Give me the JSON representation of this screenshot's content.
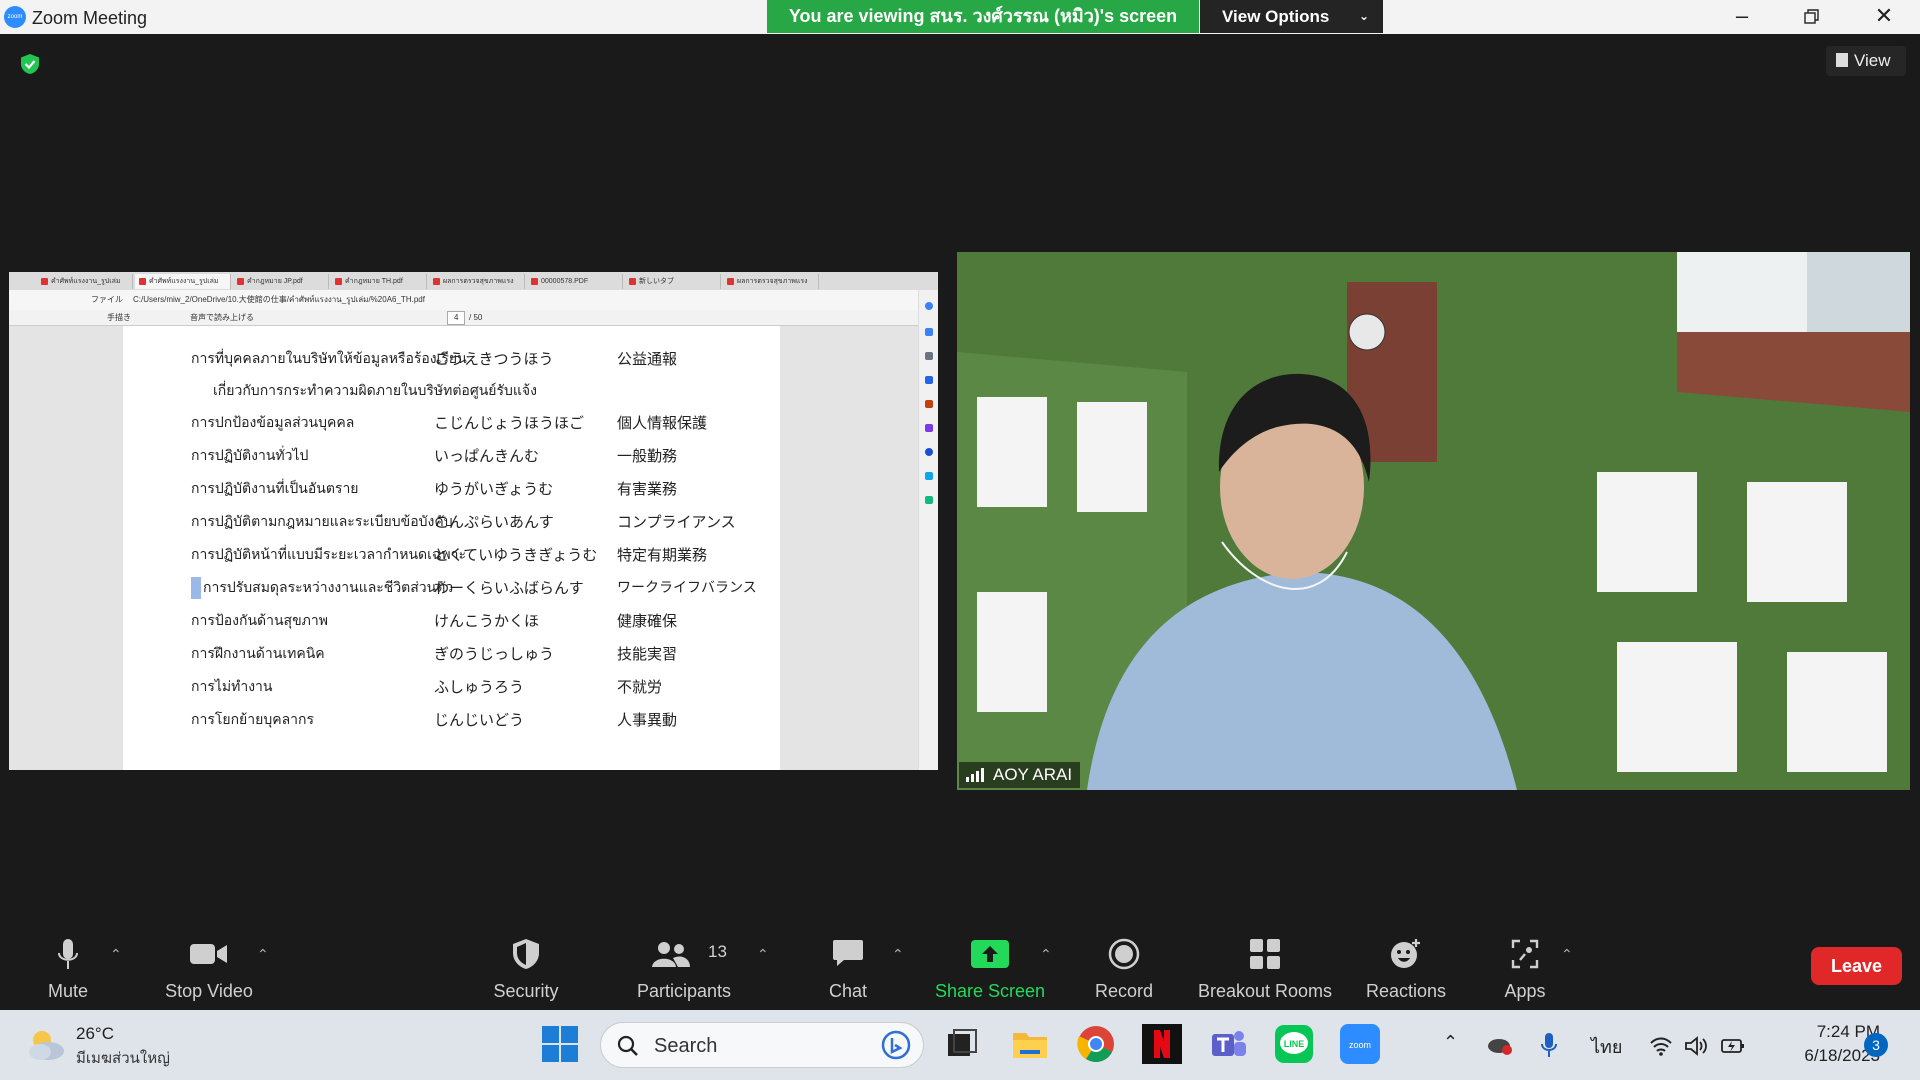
{
  "window": {
    "app_title": "Zoom Meeting",
    "logo_text": "zoom"
  },
  "banner": {
    "viewing_text": "You are viewing สนร. วงศ์วรรณ (หมิว)'s screen",
    "view_options_label": "View Options"
  },
  "view_button": {
    "label": "View"
  },
  "shared_screen": {
    "browser_tabs": [
      "คำศัพท์แรงงาน_รูปเล่ม",
      "คำศัพท์แรงงาน_รูปเล่ม",
      "คำกฎหมาย JP.pdf",
      "คำกฎหมาย TH.pdf",
      "ผลการตรวจสุขภาพแรง",
      "00000578.PDF",
      "新しいタブ",
      "ผลการตรวจสุขภาพแรง"
    ],
    "address_prefix": "ファイル",
    "address": "C:/Users/miw_2/OneDrive/10.大使館の仕事/คำศัพท์แรงงาน_รูปเล่ม/%20A6_TH.pdf",
    "pdf_toolbar": {
      "draw_label": "手描き",
      "read_aloud_label": "音声で読み上げる",
      "page_current": "4",
      "page_total": "/ 50"
    },
    "vocab_rows": [
      {
        "thai": "การที่บุคคลภายในบริษัทให้ข้อมูลหรือร้องเรียน",
        "kana": "こうえきつうほう",
        "kanji": "公益通報"
      },
      {
        "thai": "เกี่ยวกับการกระทำความผิดภายในบริษัทต่อศูนย์รับแจ้ง",
        "kana": "",
        "kanji": ""
      },
      {
        "thai": "การปกป้องข้อมูลส่วนบุคคล",
        "kana": "こじんじょうほうほご",
        "kanji": "個人情報保護"
      },
      {
        "thai": "การปฏิบัติงานทั่วไป",
        "kana": "いっぱんきんむ",
        "kanji": "一般勤務"
      },
      {
        "thai": "การปฏิบัติงานที่เป็นอันตราย",
        "kana": "ゆうがいぎょうむ",
        "kanji": "有害業務"
      },
      {
        "thai": "การปฏิบัติตามกฎหมายและระเบียบข้อบังคับ",
        "kana": "こんぷらいあんす",
        "kanji": "コンプライアンス"
      },
      {
        "thai": "การปฏิบัติหน้าที่แบบมีระยะเวลากำหนดเฉพาะ",
        "kana": "とくていゆうきぎょうむ",
        "kanji": "特定有期業務"
      },
      {
        "thai": "การปรับสมดุลระหว่างงานและชีวิตส่วนตัว",
        "kana": "わーくらいふばらんす",
        "kanji": "ワークライフバランス"
      },
      {
        "thai": "การป้องกันด้านสุขภาพ",
        "kana": "けんこうかくほ",
        "kanji": "健康確保"
      },
      {
        "thai": "การฝึกงานด้านเทคนิค",
        "kana": "ぎのうじっしゅう",
        "kanji": "技能実習"
      },
      {
        "thai": "การไม่ทำงาน",
        "kana": "ふしゅうろう",
        "kanji": "不就労"
      },
      {
        "thai": "การโยกย้ายบุคลากร",
        "kana": "じんじいどう",
        "kanji": "人事異動"
      }
    ]
  },
  "video": {
    "participant_name": "AOY ARAI"
  },
  "toolbar": {
    "mute": "Mute",
    "stop_video": "Stop Video",
    "security": "Security",
    "participants": "Participants",
    "participants_count": "13",
    "chat": "Chat",
    "share_screen": "Share Screen",
    "record": "Record",
    "breakout_rooms": "Breakout Rooms",
    "reactions": "Reactions",
    "apps": "Apps",
    "leave": "Leave"
  },
  "taskbar": {
    "weather_temp": "26°C",
    "weather_cond": "มีเมฆส่วนใหญ่",
    "search_label": "Search",
    "language": "ไทย",
    "time": "7:24 PM",
    "date": "6/18/2023",
    "notification_count": "3"
  },
  "colors": {
    "banner_green": "#27a745",
    "leave_red": "#e02828",
    "share_green": "#23d959",
    "zoom_blue": "#2d8cff"
  }
}
